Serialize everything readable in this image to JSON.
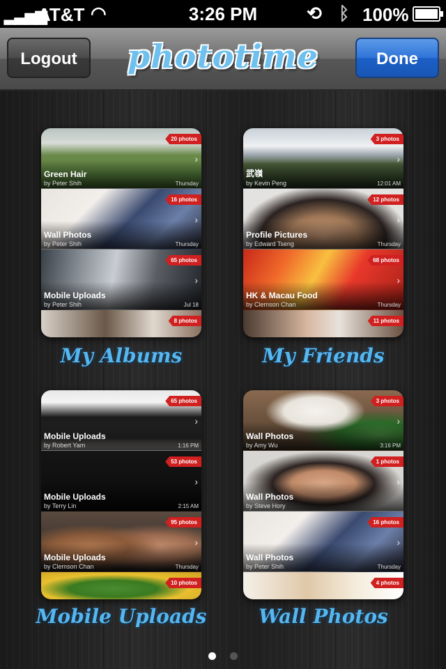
{
  "status": {
    "signal": "▂▃▅▆",
    "carrier": "AT&T",
    "time": "3:26 PM",
    "battery": "100%"
  },
  "nav": {
    "logout_label": "Logout",
    "done_label": "Done",
    "logo": "phototime"
  },
  "colors": {
    "accent": "#56b6ef",
    "done_button": "#2f74d8",
    "count_badge": "#d02020"
  },
  "groups": [
    {
      "caption": "My Albums",
      "albums": [
        {
          "title": "Green Hair",
          "by": "by Peter Shih",
          "date": "Thursday",
          "count": "20 photos"
        },
        {
          "title": "Wall Photos",
          "by": "by Peter Shih",
          "date": "Thursday",
          "count": "16 photos"
        },
        {
          "title": "Mobile Uploads",
          "by": "by Peter Shih",
          "date": "Jul 18",
          "count": "65 photos"
        },
        {
          "title": "",
          "by": "",
          "date": "",
          "count": "8 photos"
        }
      ]
    },
    {
      "caption": "My Friends",
      "albums": [
        {
          "title": "武嶺",
          "by": "by Kevin Peng",
          "date": "12:01 AM",
          "count": "3 photos"
        },
        {
          "title": "Profile Pictures",
          "by": "by Edward Tseng",
          "date": "Thursday",
          "count": "12 photos"
        },
        {
          "title": "HK & Macau Food",
          "by": "by Clemson Chan",
          "date": "Thursday",
          "count": "68 photos"
        },
        {
          "title": "",
          "by": "",
          "date": "",
          "count": "11 photos"
        }
      ]
    },
    {
      "caption": "Mobile Uploads",
      "albums": [
        {
          "title": "Mobile Uploads",
          "by": "by Robert Yam",
          "date": "1:16 PM",
          "count": "65 photos"
        },
        {
          "title": "Mobile Uploads",
          "by": "by Terry Lin",
          "date": "2:15 AM",
          "count": "53 photos"
        },
        {
          "title": "Mobile Uploads",
          "by": "by Clemson Chan",
          "date": "Thursday",
          "count": "95 photos"
        },
        {
          "title": "",
          "by": "",
          "date": "",
          "count": "10 photos"
        }
      ]
    },
    {
      "caption": "Wall Photos",
      "albums": [
        {
          "title": "Wall Photos",
          "by": "by Amy Wu",
          "date": "3:16 PM",
          "count": "3 photos"
        },
        {
          "title": "Wall Photos",
          "by": "by Steve Hory",
          "date": "",
          "count": "1 photos"
        },
        {
          "title": "Wall Photos",
          "by": "by Peter Shih",
          "date": "Thursday",
          "count": "16 photos"
        },
        {
          "title": "",
          "by": "",
          "date": "",
          "count": "4 photos"
        }
      ]
    }
  ],
  "page_control": {
    "pages": 2,
    "current": 1
  }
}
